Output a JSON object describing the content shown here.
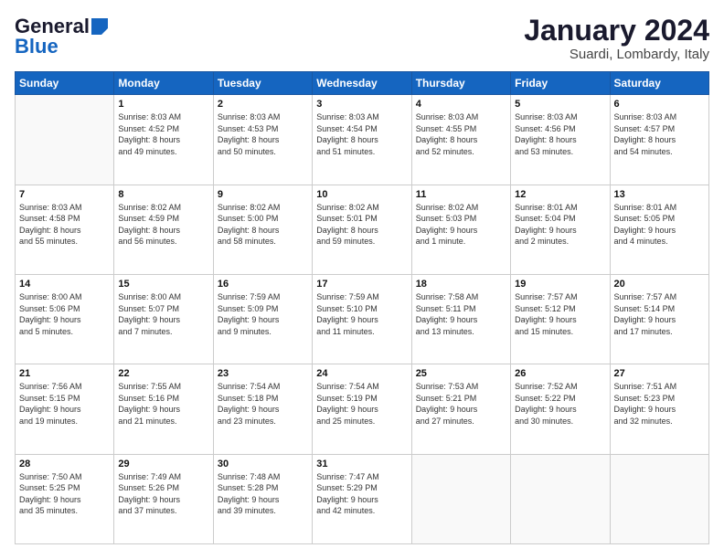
{
  "logo": {
    "line1": "General",
    "line2": "Blue"
  },
  "title": "January 2024",
  "location": "Suardi, Lombardy, Italy",
  "days_of_week": [
    "Sunday",
    "Monday",
    "Tuesday",
    "Wednesday",
    "Thursday",
    "Friday",
    "Saturday"
  ],
  "weeks": [
    [
      {
        "day": "",
        "info": ""
      },
      {
        "day": "1",
        "info": "Sunrise: 8:03 AM\nSunset: 4:52 PM\nDaylight: 8 hours\nand 49 minutes."
      },
      {
        "day": "2",
        "info": "Sunrise: 8:03 AM\nSunset: 4:53 PM\nDaylight: 8 hours\nand 50 minutes."
      },
      {
        "day": "3",
        "info": "Sunrise: 8:03 AM\nSunset: 4:54 PM\nDaylight: 8 hours\nand 51 minutes."
      },
      {
        "day": "4",
        "info": "Sunrise: 8:03 AM\nSunset: 4:55 PM\nDaylight: 8 hours\nand 52 minutes."
      },
      {
        "day": "5",
        "info": "Sunrise: 8:03 AM\nSunset: 4:56 PM\nDaylight: 8 hours\nand 53 minutes."
      },
      {
        "day": "6",
        "info": "Sunrise: 8:03 AM\nSunset: 4:57 PM\nDaylight: 8 hours\nand 54 minutes."
      }
    ],
    [
      {
        "day": "7",
        "info": "Sunrise: 8:03 AM\nSunset: 4:58 PM\nDaylight: 8 hours\nand 55 minutes."
      },
      {
        "day": "8",
        "info": "Sunrise: 8:02 AM\nSunset: 4:59 PM\nDaylight: 8 hours\nand 56 minutes."
      },
      {
        "day": "9",
        "info": "Sunrise: 8:02 AM\nSunset: 5:00 PM\nDaylight: 8 hours\nand 58 minutes."
      },
      {
        "day": "10",
        "info": "Sunrise: 8:02 AM\nSunset: 5:01 PM\nDaylight: 8 hours\nand 59 minutes."
      },
      {
        "day": "11",
        "info": "Sunrise: 8:02 AM\nSunset: 5:03 PM\nDaylight: 9 hours\nand 1 minute."
      },
      {
        "day": "12",
        "info": "Sunrise: 8:01 AM\nSunset: 5:04 PM\nDaylight: 9 hours\nand 2 minutes."
      },
      {
        "day": "13",
        "info": "Sunrise: 8:01 AM\nSunset: 5:05 PM\nDaylight: 9 hours\nand 4 minutes."
      }
    ],
    [
      {
        "day": "14",
        "info": "Sunrise: 8:00 AM\nSunset: 5:06 PM\nDaylight: 9 hours\nand 5 minutes."
      },
      {
        "day": "15",
        "info": "Sunrise: 8:00 AM\nSunset: 5:07 PM\nDaylight: 9 hours\nand 7 minutes."
      },
      {
        "day": "16",
        "info": "Sunrise: 7:59 AM\nSunset: 5:09 PM\nDaylight: 9 hours\nand 9 minutes."
      },
      {
        "day": "17",
        "info": "Sunrise: 7:59 AM\nSunset: 5:10 PM\nDaylight: 9 hours\nand 11 minutes."
      },
      {
        "day": "18",
        "info": "Sunrise: 7:58 AM\nSunset: 5:11 PM\nDaylight: 9 hours\nand 13 minutes."
      },
      {
        "day": "19",
        "info": "Sunrise: 7:57 AM\nSunset: 5:12 PM\nDaylight: 9 hours\nand 15 minutes."
      },
      {
        "day": "20",
        "info": "Sunrise: 7:57 AM\nSunset: 5:14 PM\nDaylight: 9 hours\nand 17 minutes."
      }
    ],
    [
      {
        "day": "21",
        "info": "Sunrise: 7:56 AM\nSunset: 5:15 PM\nDaylight: 9 hours\nand 19 minutes."
      },
      {
        "day": "22",
        "info": "Sunrise: 7:55 AM\nSunset: 5:16 PM\nDaylight: 9 hours\nand 21 minutes."
      },
      {
        "day": "23",
        "info": "Sunrise: 7:54 AM\nSunset: 5:18 PM\nDaylight: 9 hours\nand 23 minutes."
      },
      {
        "day": "24",
        "info": "Sunrise: 7:54 AM\nSunset: 5:19 PM\nDaylight: 9 hours\nand 25 minutes."
      },
      {
        "day": "25",
        "info": "Sunrise: 7:53 AM\nSunset: 5:21 PM\nDaylight: 9 hours\nand 27 minutes."
      },
      {
        "day": "26",
        "info": "Sunrise: 7:52 AM\nSunset: 5:22 PM\nDaylight: 9 hours\nand 30 minutes."
      },
      {
        "day": "27",
        "info": "Sunrise: 7:51 AM\nSunset: 5:23 PM\nDaylight: 9 hours\nand 32 minutes."
      }
    ],
    [
      {
        "day": "28",
        "info": "Sunrise: 7:50 AM\nSunset: 5:25 PM\nDaylight: 9 hours\nand 35 minutes."
      },
      {
        "day": "29",
        "info": "Sunrise: 7:49 AM\nSunset: 5:26 PM\nDaylight: 9 hours\nand 37 minutes."
      },
      {
        "day": "30",
        "info": "Sunrise: 7:48 AM\nSunset: 5:28 PM\nDaylight: 9 hours\nand 39 minutes."
      },
      {
        "day": "31",
        "info": "Sunrise: 7:47 AM\nSunset: 5:29 PM\nDaylight: 9 hours\nand 42 minutes."
      },
      {
        "day": "",
        "info": ""
      },
      {
        "day": "",
        "info": ""
      },
      {
        "day": "",
        "info": ""
      }
    ]
  ]
}
